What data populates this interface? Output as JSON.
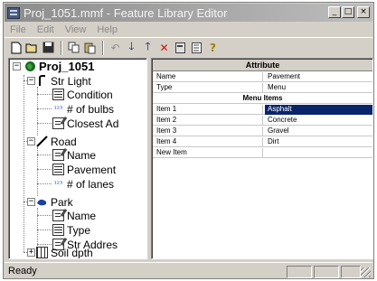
{
  "window": {
    "title": "Proj_1051.mmf - Feature Library Editor"
  },
  "menubar": [
    "File",
    "Edit",
    "View",
    "Help"
  ],
  "tree": {
    "root": "Proj_1051",
    "features": [
      {
        "label": "Str Light",
        "icon": "point-feature-icon",
        "children": [
          {
            "label": "Condition",
            "type": "menu"
          },
          {
            "label": "# of bulbs",
            "type": "numeric"
          },
          {
            "label": "Closest Ad",
            "type": "text"
          }
        ]
      },
      {
        "label": "Road",
        "icon": "line-feature-icon",
        "children": [
          {
            "label": "Name",
            "type": "text"
          },
          {
            "label": "Pavement",
            "type": "menu"
          },
          {
            "label": "# of lanes",
            "type": "numeric"
          }
        ]
      },
      {
        "label": "Park",
        "icon": "area-feature-icon",
        "children": [
          {
            "label": "Name",
            "type": "text"
          },
          {
            "label": "Type",
            "type": "menu"
          },
          {
            "label": "Str Addres",
            "type": "text"
          }
        ]
      },
      {
        "label": "Soil dpth",
        "icon": "grid-feature-icon",
        "children": []
      }
    ]
  },
  "grid": {
    "header": "Attribute",
    "name_label": "Name",
    "name_value": "Pavement",
    "type_label": "Type",
    "type_value": "Menu",
    "section": "Menu Items",
    "items": [
      {
        "label": "Item 1",
        "value": "Asphalt"
      },
      {
        "label": "Item 2",
        "value": "Concrete"
      },
      {
        "label": "Item 3",
        "value": "Gravel"
      },
      {
        "label": "Item 4",
        "value": "Dirt"
      }
    ],
    "new_item_label": "New Item"
  },
  "status": {
    "text": "Ready"
  }
}
